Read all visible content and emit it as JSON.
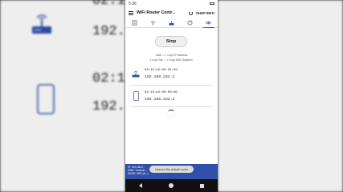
{
  "status": {
    "time": "5:36"
  },
  "appbar": {
    "title": "WiFi Router Contr...",
    "shop_label": "SHOP INFO"
  },
  "tabs": [
    "list",
    "wifi",
    "router",
    "speed",
    "eye"
  ],
  "main": {
    "stop_label": "Stop",
    "hint_click": "Click ---> Copy IP Address",
    "hint_long": "Long Click ---> Copy MAC Address"
  },
  "devices": [
    {
      "type": "router",
      "mac": "02:15:b2:00:01:00",
      "ip": "192.168.232.1"
    },
    {
      "type": "phone",
      "mac": "02:15:b2:00:00:00",
      "ip": "192.168.232.2"
    }
  ],
  "background": {
    "mac_top": "02:15",
    "ip_top": "192.",
    "mac_bottom": "02:15",
    "ip_bottom": "192."
  },
  "bottom": {
    "line1": "IP: 192.168.2...",
    "line2": "SSID: \"Android...",
    "line3": "MODE: WiFi (A...)",
    "toast": "Opened the default router"
  },
  "colors": {
    "accent": "#1f5fbf",
    "bottom_bar": "#2f4fa8",
    "router_icon": "#2f4fa8"
  }
}
